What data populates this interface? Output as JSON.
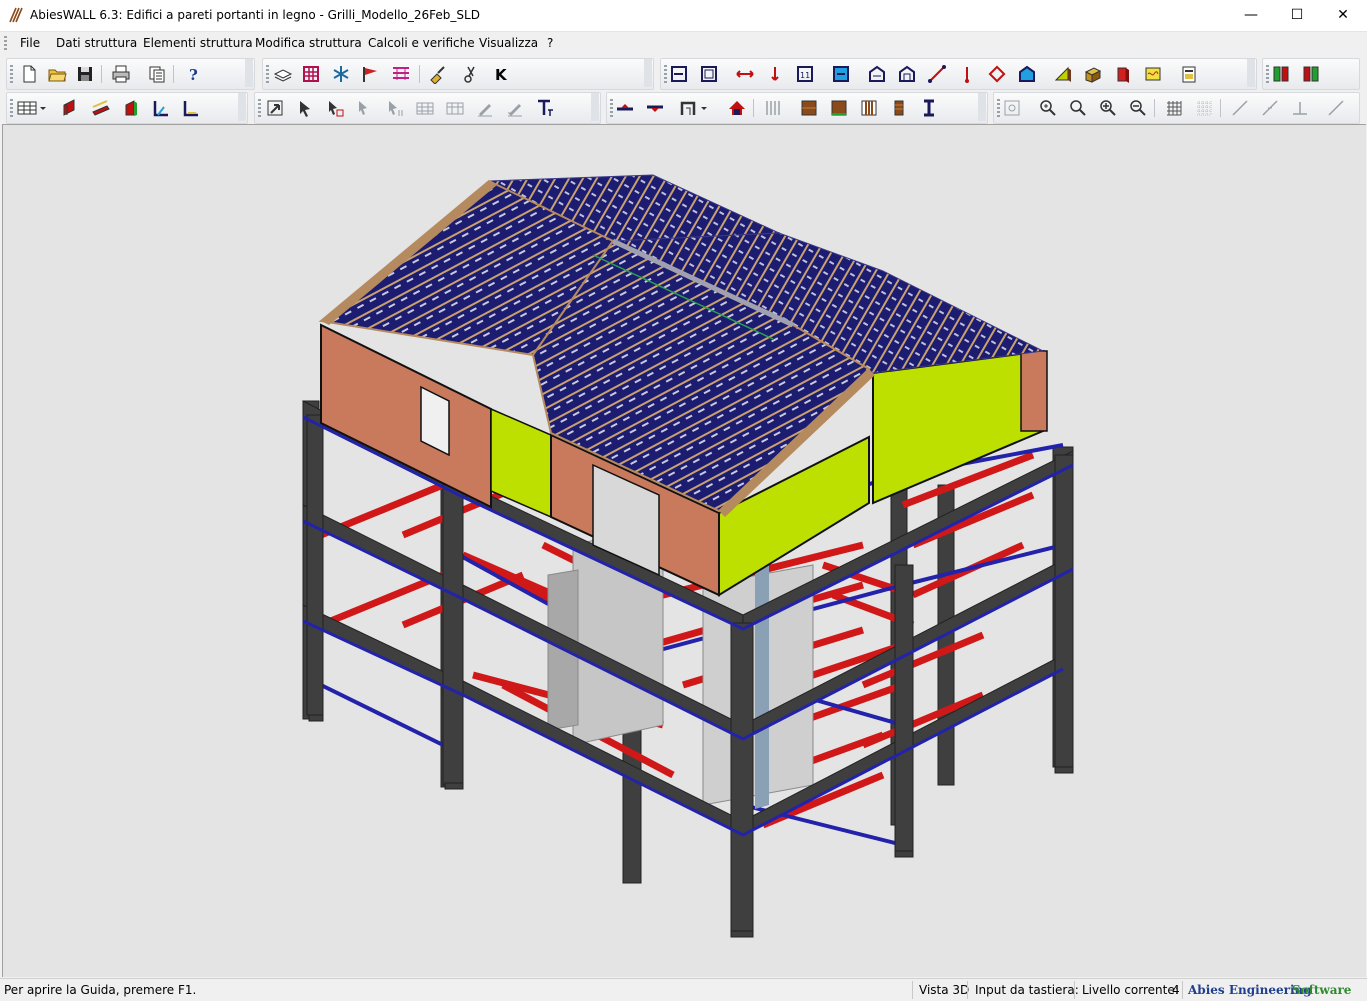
{
  "window": {
    "title": "AbiesWALL 6.3: Edifici a pareti portanti in legno - Grilli_Modello_26Feb_SLD",
    "minimize": "—",
    "maximize": "☐",
    "close": "✕"
  },
  "menu": {
    "items": [
      "File",
      "Dati struttura",
      "Elementi struttura",
      "Modifica struttura",
      "Calcoli e verifiche",
      "Visualizza",
      "?"
    ]
  },
  "status": {
    "help": "Per aprire la Guida, premere F1.",
    "view": "Vista 3D",
    "input_label": "Input da tastiera:",
    "level_label": "Livello corrente:",
    "level_value": "4",
    "brand_a": "Abies Engineering",
    "brand_b": "Software"
  },
  "colors": {
    "frame": "#3f3f3f",
    "beam_red": "#d01818",
    "beam_blue": "#2222aa",
    "wall_brown": "#c9795c",
    "wall_yellow": "#bde000",
    "roof_blue": "#1a1a6e",
    "roof_wood": "#b58a5e"
  },
  "toolbar": {
    "icons": [
      "new-icon",
      "open-icon",
      "save-icon",
      "print-icon",
      "copy-icon",
      "help-icon",
      "layers-icon",
      "grid-icon",
      "snowflake-icon",
      "wind-icon",
      "load-icon",
      "brush-icon",
      "scissors-icon",
      "k-icon"
    ]
  }
}
